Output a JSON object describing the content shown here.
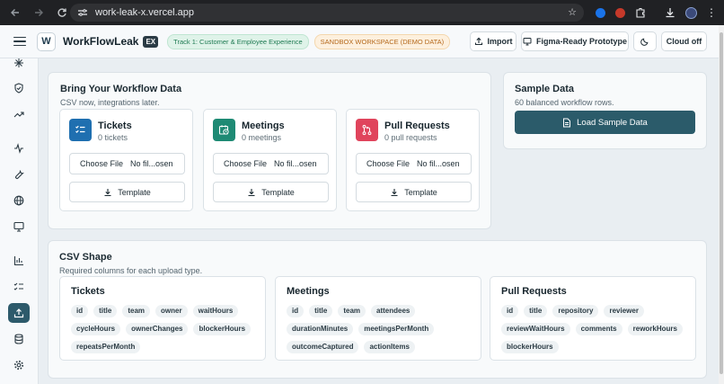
{
  "browser": {
    "url": "work-leak-x.vercel.app"
  },
  "header": {
    "logo_letter": "W",
    "brand": "WorkFlowLeak",
    "brand_badge": "EX",
    "track_pill": "Track 1: Customer & Employee Experience",
    "sandbox_pill": "SANDBOX WORKSPACE (DEMO DATA)",
    "import_label": "Import",
    "figma_label": "Figma-Ready Prototype",
    "cloud_label": "Cloud off"
  },
  "bring": {
    "title": "Bring Your Workflow Data",
    "subtitle": "CSV now, integrations later.",
    "uploads": [
      {
        "title": "Tickets",
        "count": "0 tickets",
        "choose": "Choose File",
        "file": "No fil...osen",
        "template": "Template",
        "color": "#1f6fb0"
      },
      {
        "title": "Meetings",
        "count": "0 meetings",
        "choose": "Choose File",
        "file": "No fil...osen",
        "template": "Template",
        "color": "#1e8a74"
      },
      {
        "title": "Pull Requests",
        "count": "0 pull requests",
        "choose": "Choose File",
        "file": "No fil...osen",
        "template": "Template",
        "color": "#e0445c"
      }
    ]
  },
  "sample": {
    "title": "Sample Data",
    "subtitle": "60 balanced workflow rows.",
    "button": "Load Sample Data"
  },
  "csv": {
    "title": "CSV Shape",
    "subtitle": "Required columns for each upload type.",
    "groups": [
      {
        "title": "Tickets",
        "columns": [
          "id",
          "title",
          "team",
          "owner",
          "waitHours",
          "cycleHours",
          "ownerChanges",
          "blockerHours",
          "repeatsPerMonth"
        ]
      },
      {
        "title": "Meetings",
        "columns": [
          "id",
          "title",
          "team",
          "attendees",
          "durationMinutes",
          "meetingsPerMonth",
          "outcomeCaptured",
          "actionItems"
        ]
      },
      {
        "title": "Pull Requests",
        "columns": [
          "id",
          "title",
          "repository",
          "reviewer",
          "reviewWaitHours",
          "comments",
          "reworkHours",
          "blockerHours"
        ]
      }
    ]
  }
}
